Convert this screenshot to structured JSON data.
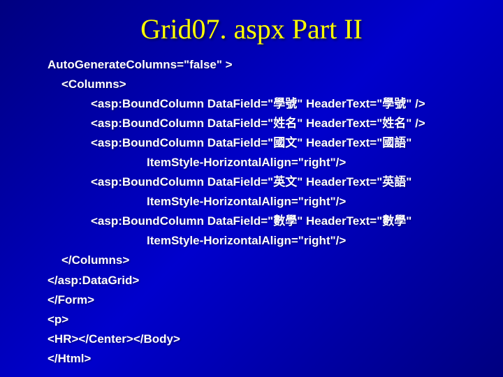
{
  "title": "Grid07. aspx Part II",
  "code": {
    "l1": "AutoGenerateColumns=\"false\" >",
    "l2": "<Columns>",
    "l3": "<asp:BoundColumn DataField=\"學號\" HeaderText=\"學號\" />",
    "l4": "<asp:BoundColumn DataField=\"姓名\" HeaderText=\"姓名\" />",
    "l5": "<asp:BoundColumn DataField=\"國文\" HeaderText=\"國語\"",
    "l6": "ItemStyle-HorizontalAlign=\"right\"/>",
    "l7": "<asp:BoundColumn DataField=\"英文\" HeaderText=\"英語\"",
    "l8": "ItemStyle-HorizontalAlign=\"right\"/>",
    "l9": "<asp:BoundColumn DataField=\"數學\" HeaderText=\"數學\"",
    "l10": "ItemStyle-HorizontalAlign=\"right\"/>",
    "l11": "</Columns>",
    "l12": "</asp:DataGrid>",
    "l13": "</Form>",
    "l14": "<p>",
    "l15": "<HR></Center></Body>",
    "l16": "</Html>"
  }
}
